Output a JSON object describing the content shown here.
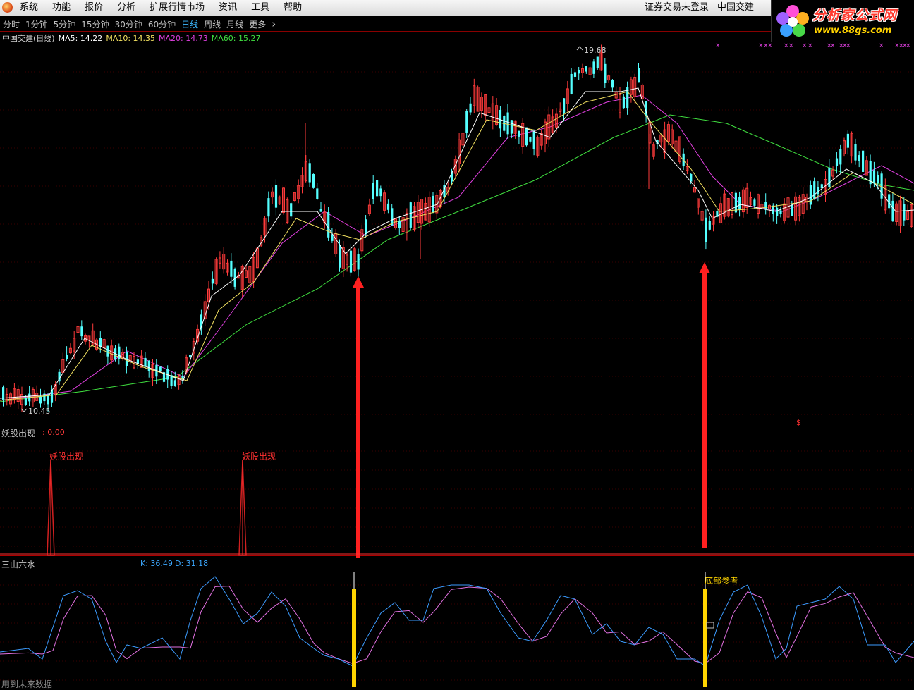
{
  "menu": {
    "items": [
      "系统",
      "功能",
      "报价",
      "分析",
      "扩展行情市场",
      "资讯",
      "工具",
      "帮助"
    ],
    "status": "证券交易未登录",
    "stock_name": "中国交建"
  },
  "logo": {
    "text": "分析家公式网",
    "url": "www.88gs.com"
  },
  "timeframes": {
    "items": [
      "分时",
      "1分钟",
      "5分钟",
      "15分钟",
      "30分钟",
      "60分钟",
      "日线",
      "周线",
      "月线",
      "更多"
    ],
    "active": "日线",
    "more_icon": "chevron-right-icon"
  },
  "main_panel": {
    "title": "中国交建(日线)",
    "ma5": "MA5: 14.22",
    "ma10": "MA10: 14.35",
    "ma20": "MA20: 14.73",
    "ma60": "MA60: 15.27",
    "high_label": "19.68",
    "low_label": "10.45",
    "colors": {
      "up": "#ff3b3b",
      "down": "#54ffff",
      "ma5": "#ffffff",
      "ma10": "#f2e060",
      "ma20": "#e040e0",
      "ma60": "#40e040"
    }
  },
  "indicator1": {
    "title": "妖股出现",
    "value": ": 0.00",
    "signal_label": "妖股出现",
    "dollar_marker": "$"
  },
  "indicator2": {
    "title": "三山六水",
    "k": "K: 36.49",
    "d": "D: 31.18",
    "bottom_label": "底部参考"
  },
  "footer": {
    "text": "用到未来数据"
  }
}
